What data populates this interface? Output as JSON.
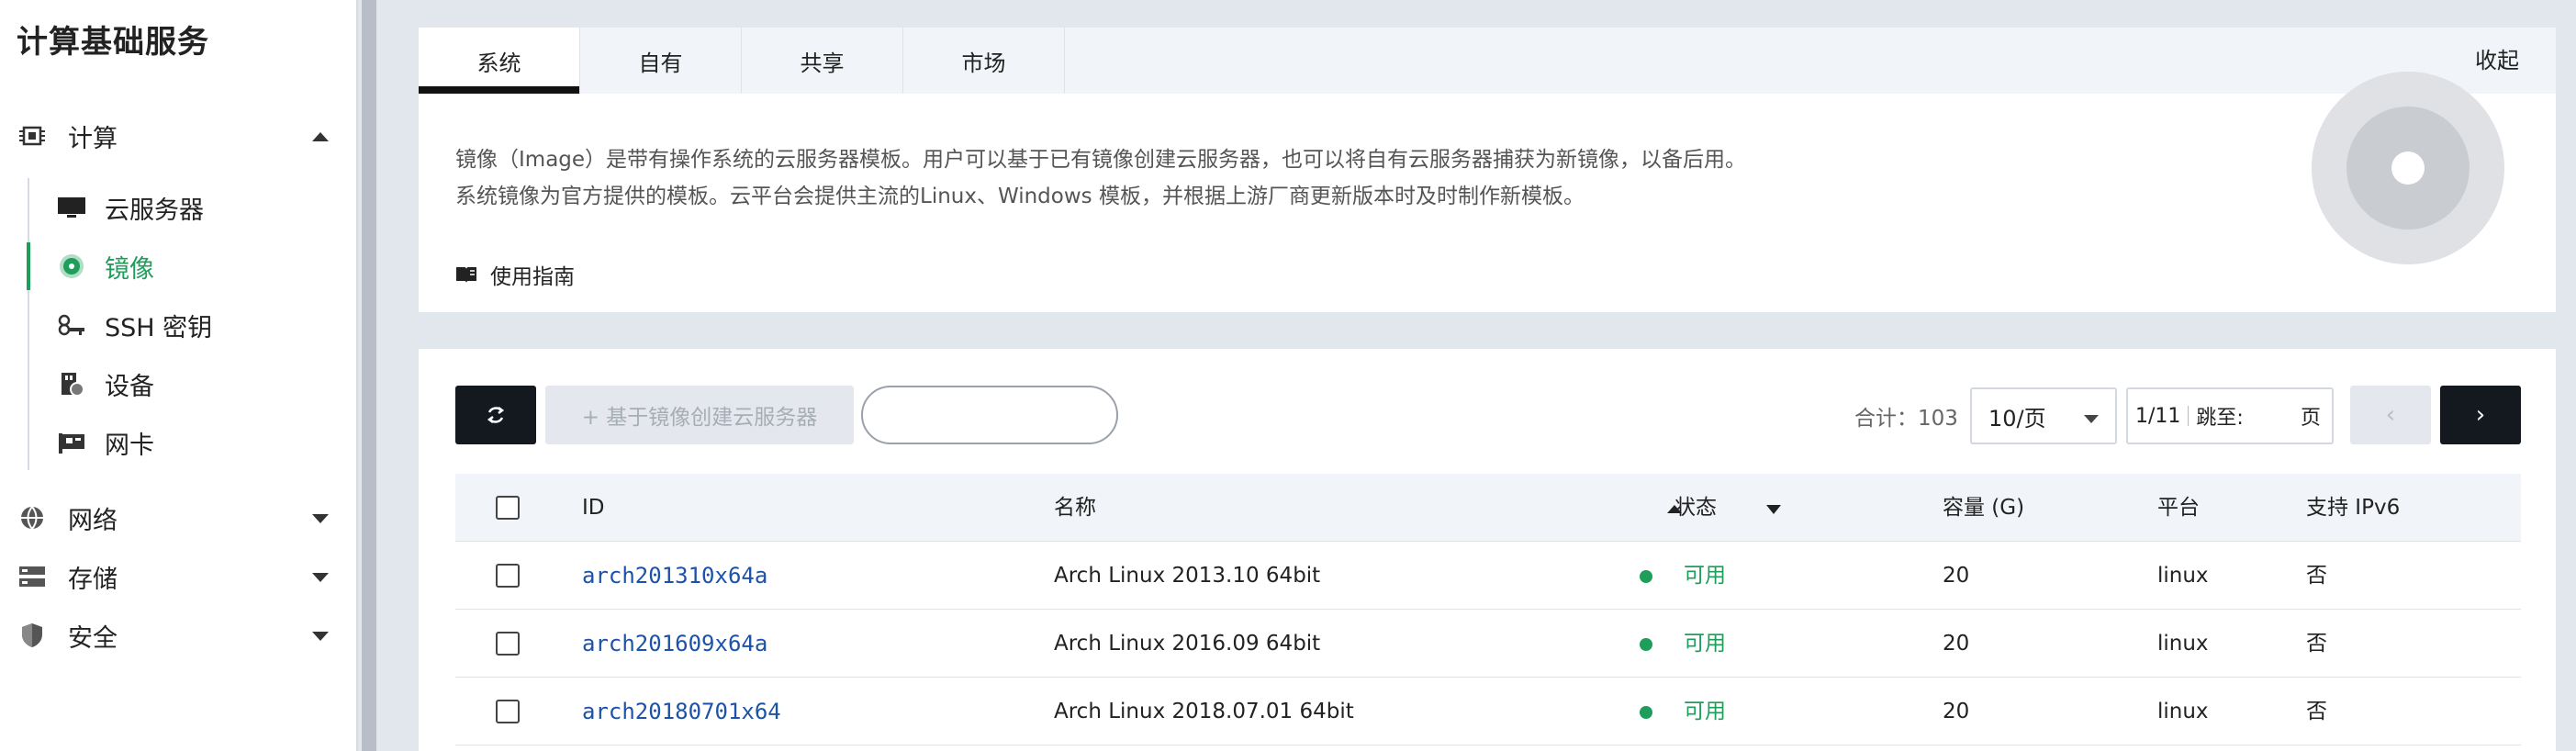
{
  "sidebar": {
    "title": "计算基础服务",
    "groups": {
      "compute": {
        "label": "计算",
        "icon": "chip-icon",
        "expanded": true
      },
      "network": {
        "label": "网络",
        "icon": "globe-icon",
        "expanded": false
      },
      "storage": {
        "label": "存储",
        "icon": "storage-icon",
        "expanded": false
      },
      "security": {
        "label": "安全",
        "icon": "shield-icon",
        "expanded": false
      }
    },
    "items": [
      {
        "label": "云服务器",
        "icon": "monitor-icon",
        "active": false
      },
      {
        "label": "镜像",
        "icon": "disc-icon",
        "active": true
      },
      {
        "label": "SSH 密钥",
        "icon": "key-icon",
        "active": false
      },
      {
        "label": "设备",
        "icon": "usb-device-icon",
        "active": false
      },
      {
        "label": "网卡",
        "icon": "nic-icon",
        "active": false
      }
    ]
  },
  "info": {
    "tabs": [
      {
        "label": "系统",
        "active": true
      },
      {
        "label": "自有",
        "active": false
      },
      {
        "label": "共享",
        "active": false
      },
      {
        "label": "市场",
        "active": false
      }
    ],
    "collapse_label": "收起",
    "desc_line1": "镜像（Image）是带有操作系统的云服务器模板。用户可以基于已有镜像创建云服务器，也可以将自有云服务器捕获为新镜像，以备后用。",
    "desc_line2": "系统镜像为官方提供的模板。云平台会提供主流的Linux、Windows 模板，并根据上游厂商更新版本时及时制作新模板。",
    "guide_label": "使用指南"
  },
  "toolbar": {
    "create_label": "+ 基于镜像创建云服务器",
    "search_placeholder": "",
    "total_text": "合计：103",
    "page_size": "10/页",
    "page_current": "1/11",
    "jump_label": "跳至:",
    "jump_unit": "页",
    "prev_symbol": "‹",
    "next_symbol": "›"
  },
  "table": {
    "headers": {
      "id": "ID",
      "name": "名称",
      "status": "状态",
      "capacity": "容量 (G)",
      "platform": "平台",
      "ipv6": "支持 IPv6"
    },
    "rows": [
      {
        "id": "arch201310x64a",
        "name": "Arch Linux 2013.10 64bit",
        "status": "可用",
        "capacity": "20",
        "platform": "linux",
        "ipv6": "否"
      },
      {
        "id": "arch201609x64a",
        "name": "Arch Linux 2016.09 64bit",
        "status": "可用",
        "capacity": "20",
        "platform": "linux",
        "ipv6": "否"
      },
      {
        "id": "arch20180701x64",
        "name": "Arch Linux 2018.07.01 64bit",
        "status": "可用",
        "capacity": "20",
        "platform": "linux",
        "ipv6": "否"
      }
    ]
  },
  "colors": {
    "accent_green": "#1f9d5b",
    "link_blue": "#1c52a8",
    "dark_button": "#14181f"
  }
}
